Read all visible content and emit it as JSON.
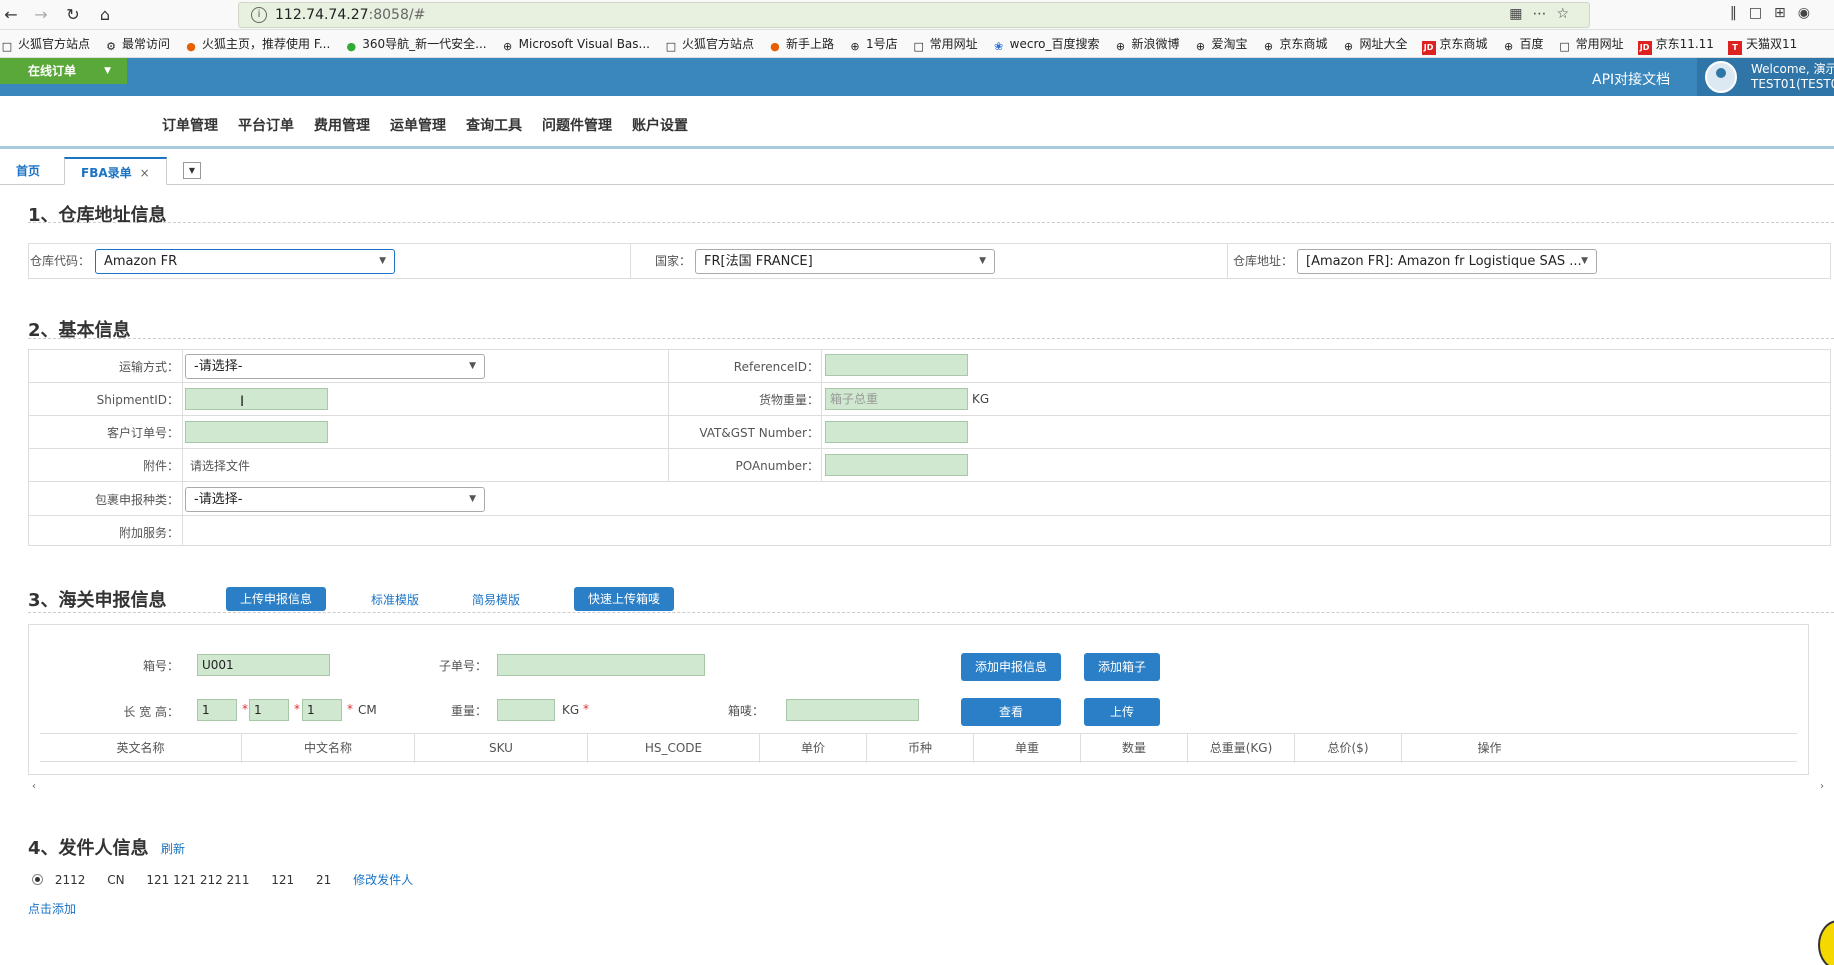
{
  "browser": {
    "url_host": "112.74.74.27",
    "url_rest": ":8058/#",
    "bookmarks": [
      {
        "label": "火狐官方站点",
        "icon": "folder-icon"
      },
      {
        "label": "最常访问",
        "icon": "gear-icon"
      },
      {
        "label": "火狐主页，推荐使用 F...",
        "icon": "firefox-icon"
      },
      {
        "label": "360导航_新一代安全...",
        "icon": "360-icon"
      },
      {
        "label": "Microsoft Visual Bas...",
        "icon": "globe-icon"
      },
      {
        "label": "火狐官方站点",
        "icon": "folder-icon"
      },
      {
        "label": "新手上路",
        "icon": "firefox-icon"
      },
      {
        "label": "1号店",
        "icon": "globe-icon"
      },
      {
        "label": "常用网址",
        "icon": "folder-icon"
      },
      {
        "label": "wecro_百度搜索",
        "icon": "paw-icon"
      },
      {
        "label": "新浪微博",
        "icon": "globe-icon"
      },
      {
        "label": "爱淘宝",
        "icon": "globe-icon"
      },
      {
        "label": "京东商城",
        "icon": "globe-icon"
      },
      {
        "label": "网址大全",
        "icon": "globe-icon"
      },
      {
        "label": "京东商城",
        "icon": "jd-icon"
      },
      {
        "label": "百度",
        "icon": "globe-icon"
      },
      {
        "label": "常用网址",
        "icon": "folder-icon"
      },
      {
        "label": "京东11.11",
        "icon": "jd-icon"
      },
      {
        "label": "天猫双11",
        "icon": "tmall-icon"
      }
    ]
  },
  "header": {
    "order_tab": "在线订单",
    "api_doc": "API对接文档",
    "welcome_line1": "Welcome, 演示",
    "welcome_line2": "TEST01(TEST0"
  },
  "menu": [
    "订单管理",
    "平台订单",
    "费用管理",
    "运单管理",
    "查询工具",
    "问题件管理",
    "账户设置"
  ],
  "tabs": {
    "home": "首页",
    "fba": "FBA录单",
    "close": "×"
  },
  "warehouse": {
    "title": "1、仓库地址信息",
    "code_label": "仓库代码：",
    "code_value": "Amazon FR",
    "country_label": "国家：",
    "country_value": "FR[法国 FRANCE]",
    "address_label": "仓库地址：",
    "address_value": "[Amazon FR]: Amazon fr Logistique SAS ..."
  },
  "basic": {
    "title": "2、基本信息",
    "transport_label": "运输方式：",
    "transport_value": "-请选择-",
    "reference_label": "ReferenceID：",
    "shipment_label": "ShipmentID：",
    "weight_label": "货物重量：",
    "weight_placeholder": "箱子总重",
    "weight_unit": "KG",
    "customer_label": "客户订单号：",
    "vat_label": "VAT&GST Number：",
    "attach_label": "附件：",
    "attach_value": "请选择文件",
    "po_label": "POAnumber：",
    "package_label": "包裹申报种类：",
    "package_value": "-请选择-",
    "extra_label": "附加服务："
  },
  "customs": {
    "title": "3、海关申报信息",
    "upload_btn": "上传申报信息",
    "std_template": "标准模版",
    "simple_template": "简易模版",
    "fast_upload_btn": "快速上传箱唛",
    "box_label": "箱号：",
    "box_value": "U001",
    "sub_label": "子单号：",
    "dims_label": "长 宽 高：",
    "dim_l": "1",
    "dim_w": "1",
    "dim_h": "1",
    "dim_unit": "CM",
    "weight_label": "重量：",
    "weight_unit": "KG",
    "mark_label": "箱唛：",
    "add_decl_btn": "添加申报信息",
    "add_box_btn": "添加箱子",
    "view_btn": "查看",
    "upload_btn2": "上传",
    "star": "*",
    "columns": [
      "英文名称",
      "中文名称",
      "SKU",
      "HS_CODE",
      "单价",
      "币种",
      "单重",
      "数量",
      "总重量(KG)",
      "总价($)",
      "操作"
    ]
  },
  "sender": {
    "title": "4、发件人信息",
    "refresh": "刷新",
    "fields": [
      "2112",
      "CN",
      "121 121 212 211",
      "121",
      "21"
    ],
    "edit": "修改发件人",
    "add": "点击添加"
  }
}
